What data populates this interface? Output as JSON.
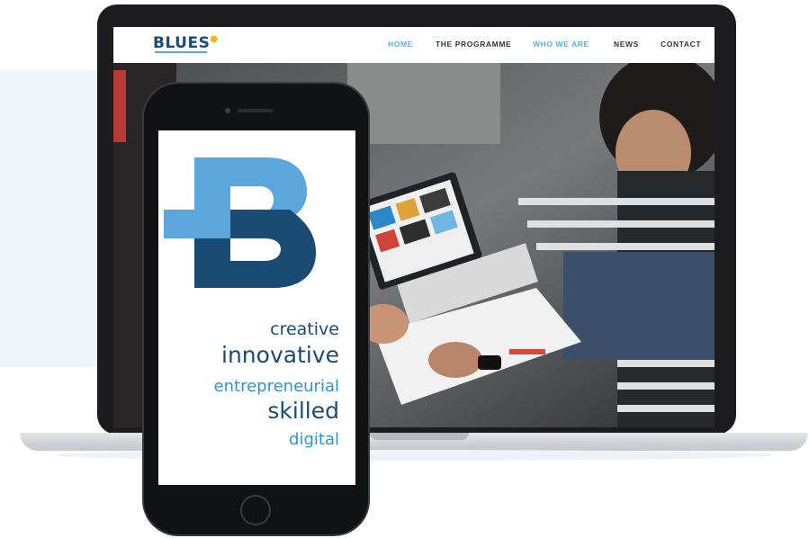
{
  "site": {
    "logo_text": "BLUES",
    "nav": [
      {
        "label": "HOME",
        "active": true
      },
      {
        "label": "THE PROGRAMME",
        "active": false
      },
      {
        "label": "WHO WE ARE",
        "active": true
      },
      {
        "label": "NEWS",
        "active": false
      },
      {
        "label": "CONTACT",
        "active": false
      }
    ]
  },
  "phone": {
    "logo_letter": "B",
    "words": [
      "creative",
      "innovative",
      "entrepreneurial",
      "skilled",
      "digital"
    ]
  },
  "colors": {
    "brand_dark": "#1a4b72",
    "brand_light": "#56aee0",
    "brand_mid": "#2e93d1",
    "accent_yellow": "#f0b31a"
  }
}
